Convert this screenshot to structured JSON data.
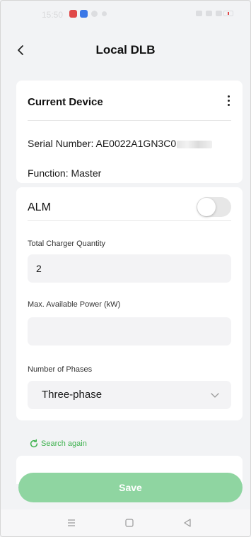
{
  "status_bar": {
    "time": "15:50"
  },
  "header": {
    "back_icon": "chevron-left-icon",
    "title": "Local DLB"
  },
  "device_card": {
    "title": "Current Device",
    "more_icon": "more-vertical-icon",
    "serial_text": "Serial Number: AE0022A1GN3C0",
    "function_text": "Function: Master"
  },
  "alm_card": {
    "alm_label": "ALM",
    "alm_enabled": false,
    "total_charger_quantity": {
      "label": "Total Charger Quantity",
      "value": "2"
    },
    "max_available_power": {
      "label": "Max. Available Power (kW)",
      "value": ""
    },
    "number_of_phases": {
      "label": "Number of Phases",
      "selected": "Three-phase"
    }
  },
  "search_again": {
    "icon": "refresh-icon",
    "label": "Search again"
  },
  "save_label": "Save",
  "colors": {
    "accent_green": "#3fb24f",
    "save_button": "#8fd5a1",
    "background": "#f2f3f5",
    "card": "#ffffff",
    "field": "#f3f3f5"
  },
  "nav_bar": {
    "icons": [
      "menu-icon",
      "home-icon",
      "back-triangle-icon"
    ]
  }
}
